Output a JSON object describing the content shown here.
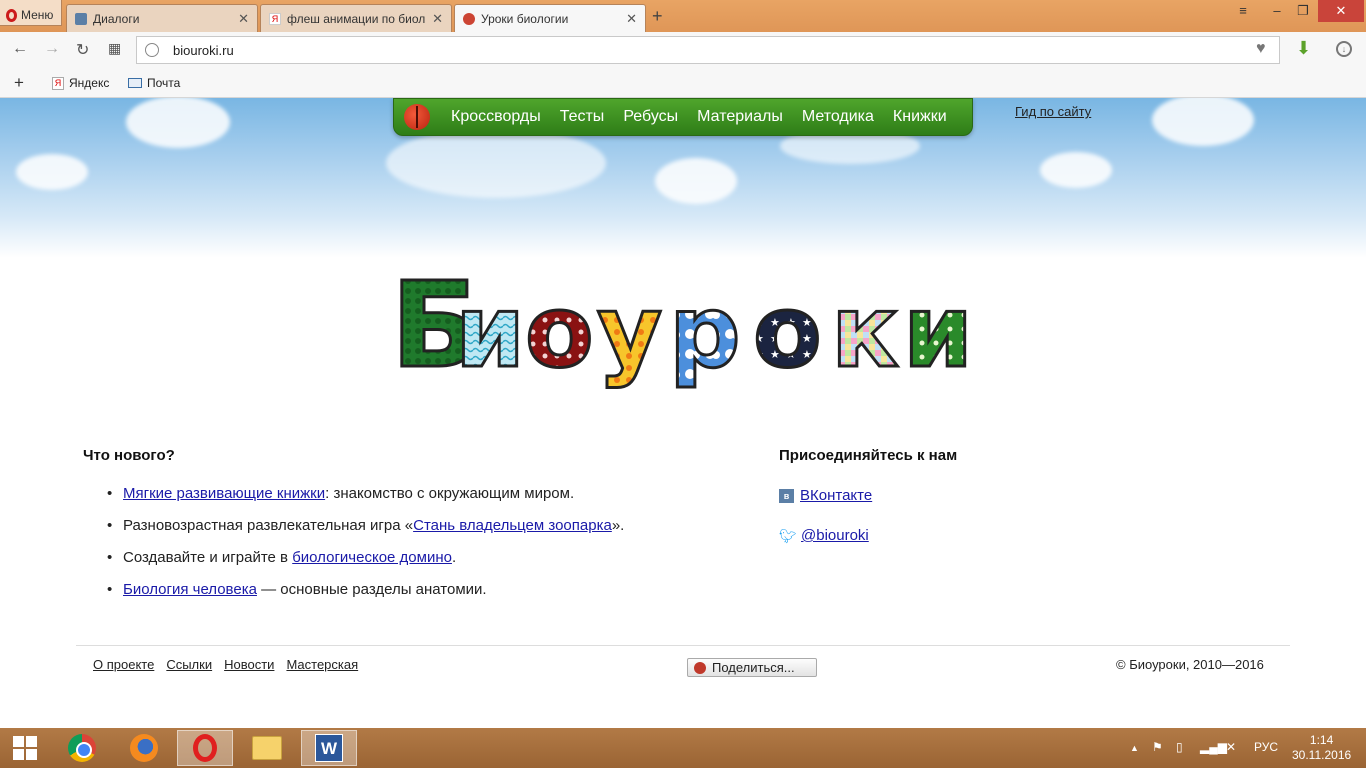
{
  "browser": {
    "menu_label": "Меню",
    "tabs": [
      {
        "label": "Диалоги"
      },
      {
        "label": "флеш анимации по биол"
      },
      {
        "label": "Уроки биологии"
      }
    ],
    "new_tab": "+",
    "address": "biouroki.ru",
    "bookmarks": [
      {
        "label": "Яндекс"
      },
      {
        "label": "Почта"
      }
    ]
  },
  "site": {
    "nav": [
      "Кроссворды",
      "Тесты",
      "Ребусы",
      "Материалы",
      "Методика",
      "Книжки"
    ],
    "guide_link": "Гид по сайту",
    "logo_text": "Биоуроки",
    "news": {
      "title": "Что нового?",
      "items": [
        {
          "link": "Мягкие развивающие книжки",
          "after": ": знакомство с окружающим миром."
        },
        {
          "before": "Разновозрастная развлекательная игра «",
          "link": "Стань владельцем зоопарка",
          "after": "»."
        },
        {
          "before": "Создавайте и играйте в ",
          "link": "биологическое домино",
          "after": "."
        },
        {
          "link": "Биология человека",
          "after": " — основные разделы анатомии."
        }
      ]
    },
    "social": {
      "title": "Присоединяйтесь к нам",
      "vk": "ВКонтакте",
      "vk_icon_letter": "в",
      "twitter": "@biouroki"
    },
    "footer": {
      "links": [
        "О проекте",
        "Ссылки",
        "Новости",
        "Мастерская"
      ],
      "share_label": "Поделиться...",
      "copyright": "© Биоуроки, 2010—2016"
    }
  },
  "taskbar": {
    "language": "РУС",
    "time": "1:14",
    "date": "30.11.2016"
  }
}
